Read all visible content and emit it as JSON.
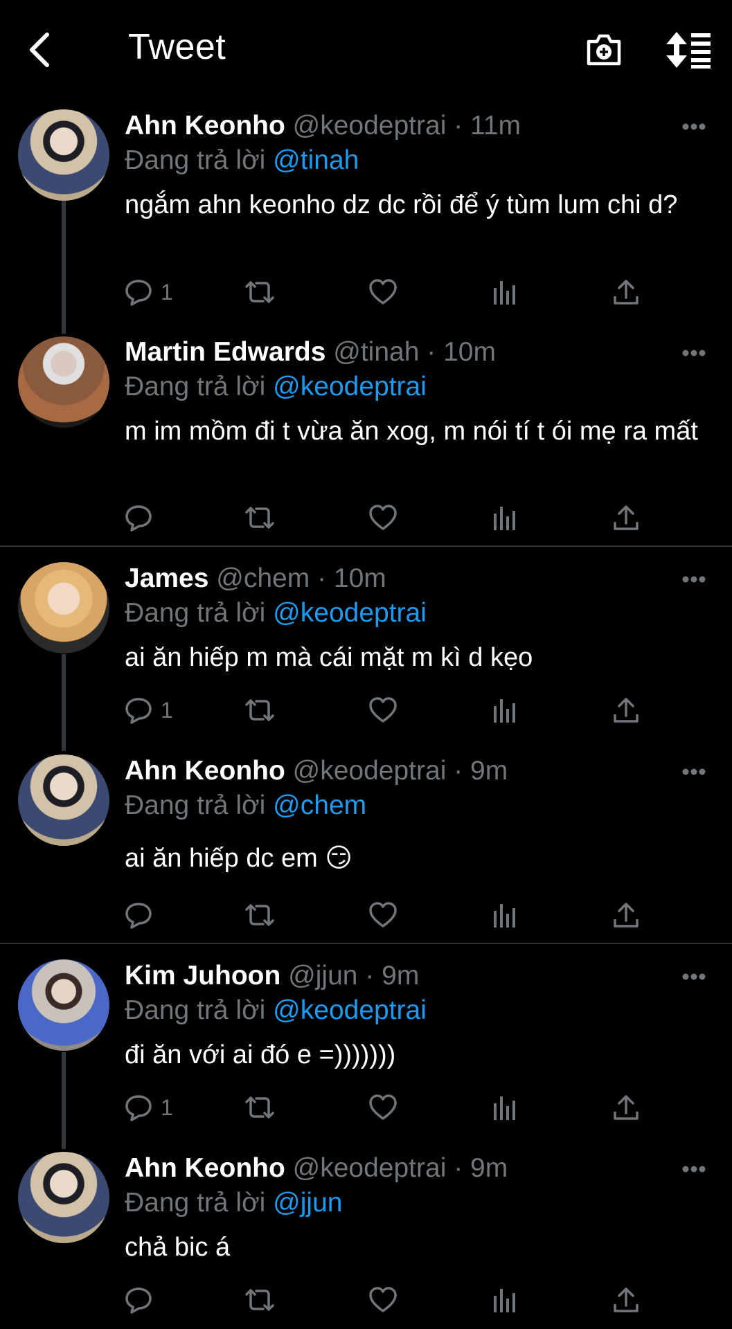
{
  "header": {
    "title": "Tweet"
  },
  "reply_prefix": "Đang trả lời",
  "tweets": [
    {
      "name": "Ahn Keonho",
      "handle": "@keodeptrai",
      "time": "11m",
      "reply_to": "@tinah",
      "text": "ngắm ahn keonho dz dc rồi để ý tùm lum chi d?",
      "replies": "1"
    },
    {
      "name": "Martin Edwards",
      "handle": "@tinah",
      "time": "10m",
      "reply_to": "@keodeptrai",
      "text": "m im mồm đi t vừa ăn xog, m nói tí t ói mẹ ra mất",
      "replies": ""
    },
    {
      "name": "James",
      "handle": "@chem",
      "time": "10m",
      "reply_to": "@keodeptrai",
      "text": "ai ăn hiếp m mà cái mặt m kì d kẹo",
      "replies": "1"
    },
    {
      "name": "Ahn Keonho",
      "handle": "@keodeptrai",
      "time": "9m",
      "reply_to": "@chem",
      "text": "ai ăn hiếp dc em 😏",
      "replies": ""
    },
    {
      "name": "Kim Juhoon",
      "handle": "@jjun",
      "time": "9m",
      "reply_to": "@keodeptrai",
      "text": "đi ăn với ai đó e =)))))))",
      "replies": "1"
    },
    {
      "name": "Ahn Keonho",
      "handle": "@keodeptrai",
      "time": "9m",
      "reply_to": "@jjun",
      "text": "chả bic á",
      "replies": ""
    }
  ]
}
